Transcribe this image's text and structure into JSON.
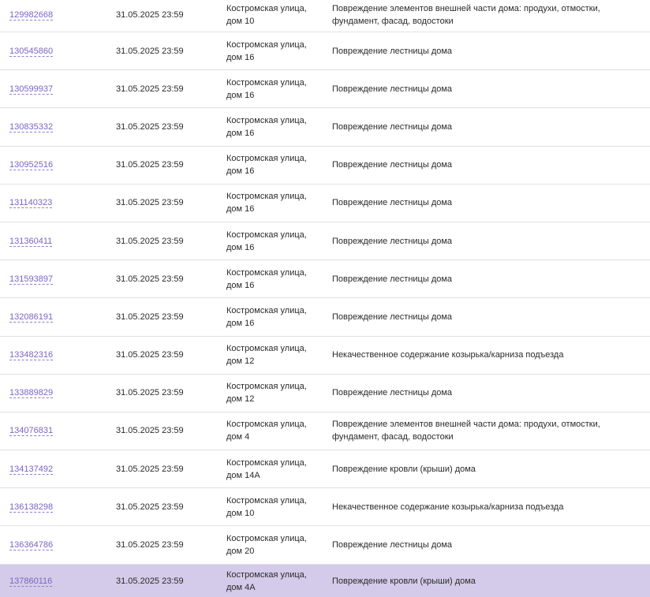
{
  "rows": [
    {
      "id": "129982668",
      "date": "31.05.2025 23:59",
      "addr1": "Костромская улица,",
      "addr2": "дом 10",
      "desc": "Повреждение элементов внешней части дома: продухи, отмостки, фундамент, фасад, водостоки"
    },
    {
      "id": "130545860",
      "date": "31.05.2025 23:59",
      "addr1": "Костромская улица,",
      "addr2": "дом 16",
      "desc": "Повреждение лестницы дома"
    },
    {
      "id": "130599937",
      "date": "31.05.2025 23:59",
      "addr1": "Костромская улица,",
      "addr2": "дом 16",
      "desc": "Повреждение лестницы дома"
    },
    {
      "id": "130835332",
      "date": "31.05.2025 23:59",
      "addr1": "Костромская улица,",
      "addr2": "дом 16",
      "desc": "Повреждение лестницы дома"
    },
    {
      "id": "130952516",
      "date": "31.05.2025 23:59",
      "addr1": "Костромская улица,",
      "addr2": "дом 16",
      "desc": "Повреждение лестницы дома"
    },
    {
      "id": "131140323",
      "date": "31.05.2025 23:59",
      "addr1": "Костромская улица,",
      "addr2": "дом 16",
      "desc": "Повреждение лестницы дома"
    },
    {
      "id": "131360411",
      "date": "31.05.2025 23:59",
      "addr1": "Костромская улица,",
      "addr2": "дом 16",
      "desc": "Повреждение лестницы дома"
    },
    {
      "id": "131593897",
      "date": "31.05.2025 23:59",
      "addr1": "Костромская улица,",
      "addr2": "дом 16",
      "desc": "Повреждение лестницы дома"
    },
    {
      "id": "132086191",
      "date": "31.05.2025 23:59",
      "addr1": "Костромская улица,",
      "addr2": "дом 16",
      "desc": "Повреждение лестницы дома"
    },
    {
      "id": "133482316",
      "date": "31.05.2025 23:59",
      "addr1": "Костромская улица,",
      "addr2": "дом 12",
      "desc": "Некачественное содержание козырька/карниза подъезда"
    },
    {
      "id": "133889829",
      "date": "31.05.2025 23:59",
      "addr1": "Костромская улица,",
      "addr2": "дом 12",
      "desc": "Повреждение лестницы дома"
    },
    {
      "id": "134076831",
      "date": "31.05.2025 23:59",
      "addr1": "Костромская улица,",
      "addr2": "дом 4",
      "desc": "Повреждение элементов внешней части дома: продухи, отмостки, фундамент, фасад, водостоки"
    },
    {
      "id": "134137492",
      "date": "31.05.2025 23:59",
      "addr1": "Костромская улица,",
      "addr2": "дом 14А",
      "desc": "Повреждение кровли (крыши) дома"
    },
    {
      "id": "136138298",
      "date": "31.05.2025 23:59",
      "addr1": "Костромская улица,",
      "addr2": "дом 10",
      "desc": "Некачественное содержание козырька/карниза подъезда"
    },
    {
      "id": "136364786",
      "date": "31.05.2025 23:59",
      "addr1": "Костромская улица,",
      "addr2": "дом 20",
      "desc": "Повреждение лестницы дома"
    },
    {
      "id": "137860116",
      "date": "31.05.2025 23:59",
      "addr1": "Костромская улица,",
      "addr2": "дом 4А",
      "desc": "Повреждение кровли (крыши) дома",
      "selected": true
    }
  ],
  "colors": {
    "link": "#7a66c2",
    "selected_row": "#d3cbe9",
    "divider": "#e2e2e2"
  }
}
